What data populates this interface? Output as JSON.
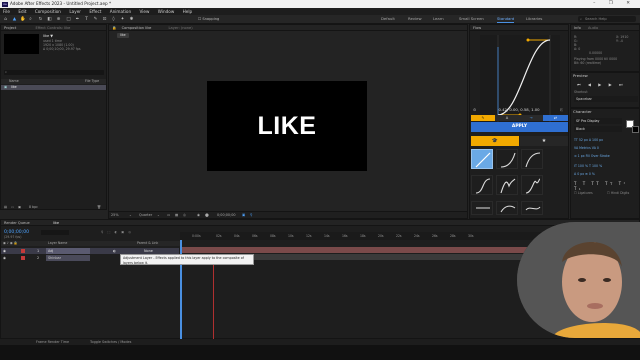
{
  "window": {
    "title": "Adobe After Effects 2023 - Untitled Project.aep *",
    "logo": "Ae",
    "controls": "–  ❐  ✕"
  },
  "menu": [
    "File",
    "Edit",
    "Composition",
    "Layer",
    "Effect",
    "Animation",
    "View",
    "Window",
    "Help"
  ],
  "toolbar": {
    "snapping": "Snapping",
    "workspaces": [
      "Default",
      "Review",
      "Learn",
      "Small Screen",
      "Standard",
      "Libraries"
    ],
    "active_workspace": "Standard",
    "search_placeholder": "Search Help"
  },
  "project": {
    "tab": "Project",
    "effect_tab": "Effect Controls: like",
    "item_name": "like ▼",
    "item_info": [
      "used 1 time",
      "1920 x 1080 (1.00)",
      "Δ 0;00;10;00, 29.97 fps"
    ],
    "columns": {
      "name": "Name",
      "type": "File Type"
    },
    "items": [
      {
        "name": "like"
      }
    ],
    "footer_bpc": "8 bpc"
  },
  "composition": {
    "tab": "Composition like",
    "sub_tab": "like",
    "layer_tab": "Layer: (none)",
    "canvas_text": "LIKE",
    "zoom": "25%",
    "resolution": "Quarter",
    "timecode": "0;00;00;00"
  },
  "flow": {
    "tab": "Flow",
    "values": "0.42, 0.00, 0.58, 1.00",
    "apply": "APPLY",
    "accent": "#f2a900",
    "preset_labels": [
      "Linear",
      "Ease In",
      "Ease Out",
      "Ease In Out",
      "Bounce",
      "Elastic"
    ]
  },
  "info_panel": {
    "tab": "Info",
    "tab2": "Audio",
    "lines": [
      "R:",
      "G:",
      "B:",
      "A: 0"
    ],
    "right_lines": [
      "X: 1910",
      "Y: -4"
    ],
    "notes": [
      "0.00000",
      "Playing from 0000 till 0000",
      "Bit: 60 (realtime)"
    ]
  },
  "preview": {
    "tab": "Preview",
    "shortcut_label": "Shortcut",
    "shortcut_value": "Spacebar"
  },
  "character": {
    "tab": "Character",
    "font": "SF Pro Display",
    "style": "Black",
    "ligatures": "Ligatures",
    "hindi": "Hindi Digits"
  },
  "timeline": {
    "render_tab": "Render Queue",
    "comp_tab": "like",
    "timecode": "0;00;00;00",
    "fps": "(29.97 fps)",
    "columns": {
      "layer_name": "Layer Name",
      "parent": "Parent & Link"
    },
    "layers": [
      {
        "index": "1",
        "name": "Adj",
        "parent": "None"
      },
      {
        "index": "2",
        "name": "Shinbar",
        "parent": "None"
      }
    ],
    "ruler": [
      "0:00s",
      "02s",
      "04s",
      "06s",
      "08s",
      "10s",
      "12s",
      "14s",
      "16s",
      "18s",
      "20s",
      "22s",
      "24s",
      "26s",
      "28s",
      "30s"
    ],
    "footer_left": "Frame Render Time",
    "footer_mid": "Toggle Switches / Modes"
  },
  "tooltip": {
    "text": "Adjustment Layer - Effects applied to this layer apply to the composite of layers below it."
  }
}
